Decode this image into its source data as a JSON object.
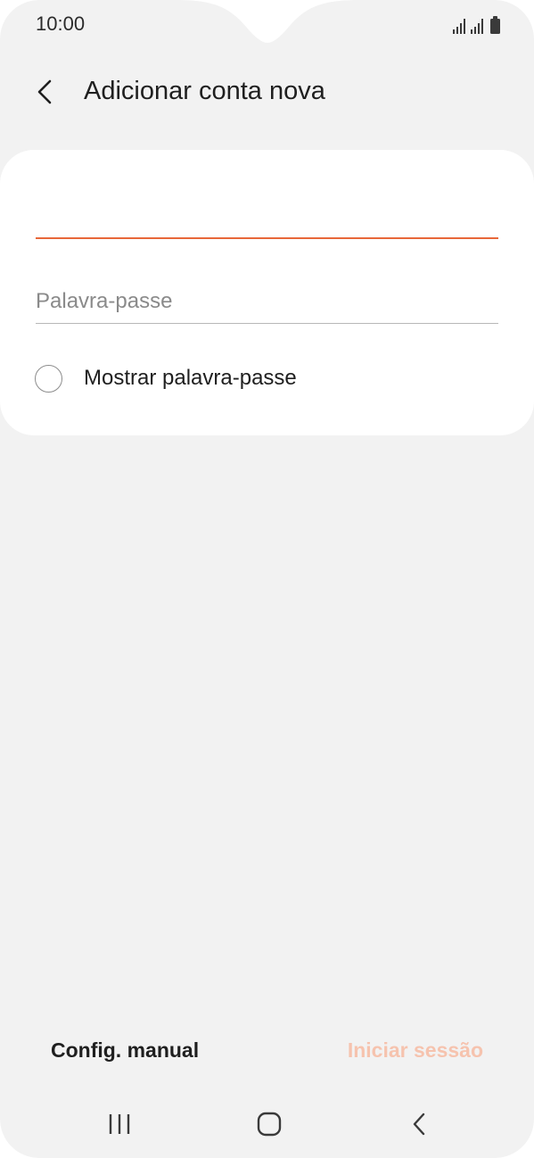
{
  "status_bar": {
    "time": "10:00"
  },
  "header": {
    "title": "Adicionar conta nova"
  },
  "form": {
    "email_value": "",
    "password_placeholder": "Palavra-passe",
    "show_password_label": "Mostrar palavra-passe",
    "show_password_checked": false
  },
  "actions": {
    "manual_config_label": "Config. manual",
    "sign_in_label": "Iniciar sessão"
  },
  "icons": {
    "back": "chevron-left-icon",
    "nav_recents": "recents-icon",
    "nav_home": "home-icon",
    "nav_back": "back-icon"
  },
  "colors": {
    "accent": "#e8683a",
    "disabled_accent": "#f6c3ae",
    "background": "#f2f2f2",
    "card": "#ffffff"
  }
}
